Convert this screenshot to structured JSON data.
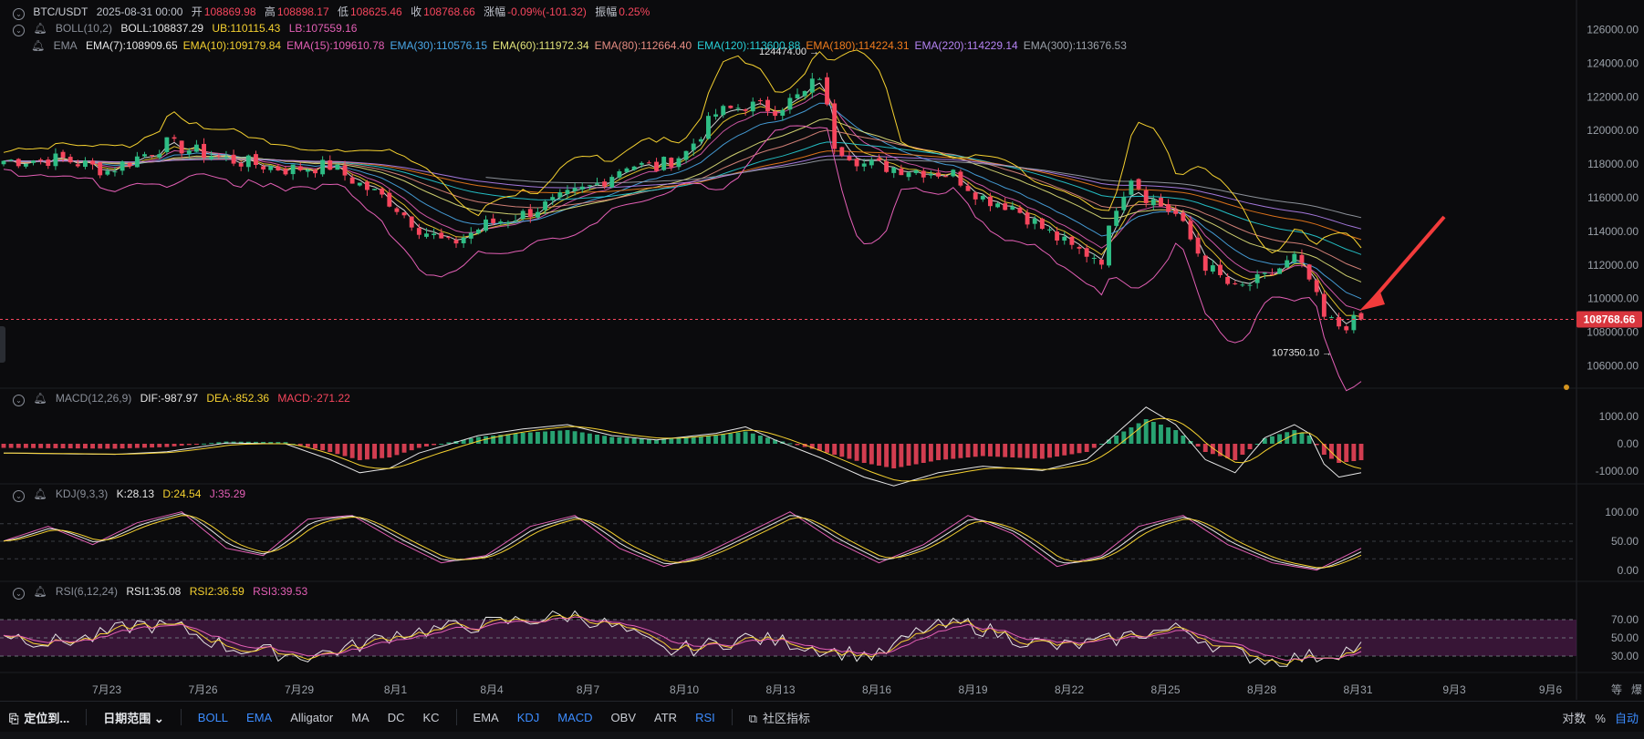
{
  "header": {
    "pair": "BTC/USDT",
    "datetime": "2025-08-31 00:00",
    "open_label": "开",
    "open": "108869.98",
    "high_label": "高",
    "high": "108898.17",
    "low_label": "低",
    "low": "108625.46",
    "close_label": "收",
    "close": "108768.66",
    "change_label": "涨幅",
    "change": "-0.09%(-101.32)",
    "amp_label": "振幅",
    "amp": "0.25%"
  },
  "legends": {
    "boll": {
      "name": "BOLL(10,2)",
      "mid": "BOLL:108837.29",
      "ub": "UB:110115.43",
      "lb": "LB:107559.16"
    },
    "ema": {
      "name": "EMA",
      "items": [
        {
          "text": "EMA(7):108909.65",
          "color": "#e6e6e6"
        },
        {
          "text": "EMA(10):109179.84",
          "color": "#f5d130"
        },
        {
          "text": "EMA(15):109610.78",
          "color": "#e35fb5"
        },
        {
          "text": "EMA(30):110576.15",
          "color": "#4aa8e8"
        },
        {
          "text": "EMA(60):111972.34",
          "color": "#e2e37a"
        },
        {
          "text": "EMA(80):112664.40",
          "color": "#e68c82"
        },
        {
          "text": "EMA(120):113600.88",
          "color": "#27cfd6"
        },
        {
          "text": "EMA(180):114224.31",
          "color": "#f07c1d"
        },
        {
          "text": "EMA(220):114229.14",
          "color": "#b483f2"
        },
        {
          "text": "EMA(300):113676.53",
          "color": "#9aa0a8"
        }
      ]
    },
    "macd": {
      "name": "MACD(12,26,9)",
      "dif": "DIF:-987.97",
      "dea": "DEA:-852.36",
      "macd": "MACD:-271.22"
    },
    "kdj": {
      "name": "KDJ(9,3,3)",
      "k": "K:28.13",
      "d": "D:24.54",
      "j": "J:35.29"
    },
    "rsi": {
      "name": "RSI(6,12,24)",
      "r1": "RSI1:35.08",
      "r2": "RSI2:36.59",
      "r3": "RSI3:39.53"
    }
  },
  "colors": {
    "up": "#2ebd85",
    "down": "#f6465d",
    "accent": "#3c8cff",
    "bg": "#0b0b0d",
    "arrow": "#f23b3b"
  },
  "chart_data": {
    "type": "candlestick",
    "price_axis": {
      "ticks": [
        "126000.00",
        "124000.00",
        "122000.00",
        "120000.00",
        "118000.00",
        "116000.00",
        "114000.00",
        "112000.00",
        "110000.00",
        "108000.00",
        "106000.00"
      ],
      "ylim": [
        105000,
        127000
      ]
    },
    "macd_axis": {
      "ticks": [
        "1000.00",
        "0.00",
        "-1000.00"
      ]
    },
    "kdj_axis": {
      "ticks": [
        "100.00",
        "50.00",
        "0.00"
      ]
    },
    "rsi_axis": {
      "ticks": [
        "70.00",
        "50.00",
        "30.00"
      ]
    },
    "x_ticks": [
      "7月23",
      "7月26",
      "7月29",
      "8月1",
      "8月4",
      "8月7",
      "8月10",
      "8月13",
      "8月16",
      "8月19",
      "8月22",
      "8月25",
      "8月28",
      "8月31",
      "9月3",
      "9月6"
    ],
    "last_price": "108768.66",
    "annotations": {
      "max_label": "124474.00 →",
      "min_label": "107350.10 →"
    },
    "close_anchors": [
      [
        0,
        118200
      ],
      [
        8,
        118300
      ],
      [
        14,
        117600
      ],
      [
        22,
        119200
      ],
      [
        30,
        118300
      ],
      [
        38,
        117700
      ],
      [
        44,
        117900
      ],
      [
        48,
        116800
      ],
      [
        52,
        115800
      ],
      [
        56,
        114200
      ],
      [
        60,
        113200
      ],
      [
        65,
        114400
      ],
      [
        70,
        115000
      ],
      [
        75,
        115900
      ],
      [
        80,
        116800
      ],
      [
        84,
        118000
      ],
      [
        88,
        117800
      ],
      [
        92,
        118700
      ],
      [
        96,
        121000
      ],
      [
        100,
        121500
      ],
      [
        104,
        121300
      ],
      [
        108,
        122200
      ],
      [
        110,
        123300
      ],
      [
        112,
        119200
      ],
      [
        116,
        118000
      ],
      [
        120,
        117800
      ],
      [
        124,
        117600
      ],
      [
        128,
        117400
      ],
      [
        132,
        116000
      ],
      [
        136,
        115500
      ],
      [
        140,
        114200
      ],
      [
        144,
        113000
      ],
      [
        148,
        112400
      ],
      [
        150,
        115600
      ],
      [
        152,
        117300
      ],
      [
        154,
        116100
      ],
      [
        158,
        115000
      ],
      [
        162,
        112000
      ],
      [
        166,
        110500
      ],
      [
        170,
        111200
      ],
      [
        174,
        112400
      ],
      [
        176,
        111100
      ],
      [
        178,
        108800
      ],
      [
        180,
        108400
      ],
      [
        182,
        108600
      ],
      [
        183,
        108770
      ]
    ],
    "n_candles": 184,
    "overlay_hlines": {
      "ema": 10
    },
    "macd_hist_pattern": [
      [
        0,
        -150
      ],
      [
        15,
        -180
      ],
      [
        22,
        -120
      ],
      [
        30,
        80
      ],
      [
        38,
        60
      ],
      [
        44,
        -300
      ],
      [
        48,
        -600
      ],
      [
        52,
        -500
      ],
      [
        56,
        -150
      ],
      [
        64,
        250
      ],
      [
        70,
        400
      ],
      [
        76,
        500
      ],
      [
        82,
        250
      ],
      [
        88,
        150
      ],
      [
        96,
        300
      ],
      [
        100,
        450
      ],
      [
        104,
        150
      ],
      [
        110,
        -250
      ],
      [
        116,
        -700
      ],
      [
        120,
        -900
      ],
      [
        126,
        -600
      ],
      [
        132,
        -450
      ],
      [
        140,
        -550
      ],
      [
        146,
        -300
      ],
      [
        150,
        300
      ],
      [
        154,
        900
      ],
      [
        158,
        500
      ],
      [
        162,
        -300
      ],
      [
        166,
        -600
      ],
      [
        170,
        200
      ],
      [
        174,
        500
      ],
      [
        176,
        300
      ],
      [
        178,
        -400
      ],
      [
        180,
        -700
      ],
      [
        183,
        -600
      ]
    ],
    "kdj_pattern": [
      0.5,
      0.7,
      0.45,
      0.75,
      0.9,
      0.4,
      0.3,
      0.8,
      0.85,
      0.5,
      0.2,
      0.3,
      0.7,
      0.85,
      0.4,
      0.15,
      0.3,
      0.6,
      0.9,
      0.5,
      0.2,
      0.45,
      0.85,
      0.6,
      0.15,
      0.3,
      0.7,
      0.85,
      0.45,
      0.2,
      0.1,
      0.4
    ],
    "rsi_pattern": [
      0.55,
      0.45,
      0.5,
      0.65,
      0.6,
      0.4,
      0.35,
      0.3,
      0.4,
      0.55,
      0.6,
      0.65,
      0.7,
      0.75,
      0.6,
      0.35,
      0.4,
      0.5,
      0.45,
      0.35,
      0.3,
      0.6,
      0.65,
      0.5,
      0.4,
      0.45,
      0.55,
      0.6,
      0.35,
      0.25,
      0.3,
      0.4
    ]
  },
  "toolbar": {
    "locate": "定位到...",
    "date_range": "日期范围",
    "main_indicators": [
      "BOLL",
      "EMA",
      "Alligator",
      "MA",
      "DC",
      "KC"
    ],
    "main_active": [
      "BOLL",
      "EMA"
    ],
    "sub_indicators": [
      "EMA",
      "KDJ",
      "MACD",
      "OBV",
      "ATR",
      "RSI"
    ],
    "sub_active": [
      "KDJ",
      "MACD",
      "RSI"
    ],
    "community": "社区指标",
    "right": [
      "对数",
      "%",
      "自动"
    ],
    "right_active": "自动",
    "xaxis_right": [
      "等",
      "爆"
    ]
  }
}
